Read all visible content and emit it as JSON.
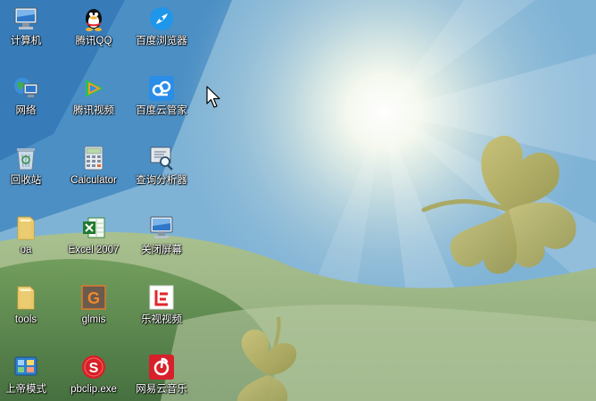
{
  "desktop": {
    "icons": [
      {
        "label": "计算机",
        "icon": "computer-icon"
      },
      {
        "label": "腾讯QQ",
        "icon": "qq-penguin-icon"
      },
      {
        "label": "百度浏览器",
        "icon": "baidu-browser-icon"
      },
      {
        "label": "网络",
        "icon": "network-icon"
      },
      {
        "label": "腾讯视频",
        "icon": "tencent-video-icon"
      },
      {
        "label": "百度云管家",
        "icon": "baidu-cloud-icon"
      },
      {
        "label": "回收站",
        "icon": "recycle-bin-icon"
      },
      {
        "label": "Calculator",
        "icon": "calculator-icon"
      },
      {
        "label": "查询分析器",
        "icon": "query-analyzer-icon"
      },
      {
        "label": "oa",
        "icon": "folder-icon"
      },
      {
        "label": "Excel 2007",
        "icon": "excel-icon"
      },
      {
        "label": "关闭屏幕",
        "icon": "monitor-off-icon"
      },
      {
        "label": "tools",
        "icon": "folder-icon"
      },
      {
        "label": "glmis",
        "icon": "glmis-g-icon"
      },
      {
        "label": "乐视视频",
        "icon": "letv-icon"
      },
      {
        "label": "上帝模式",
        "icon": "god-mode-icon"
      },
      {
        "label": "pbclip.exe",
        "icon": "pbclip-icon"
      },
      {
        "label": "网易云音乐",
        "icon": "netease-music-icon"
      }
    ]
  },
  "colors": {
    "sky_top": "#2f7fbf",
    "sun_glow": "#ffffff",
    "hill_green": "#5f8a4e",
    "clover": "#b9b46a"
  }
}
